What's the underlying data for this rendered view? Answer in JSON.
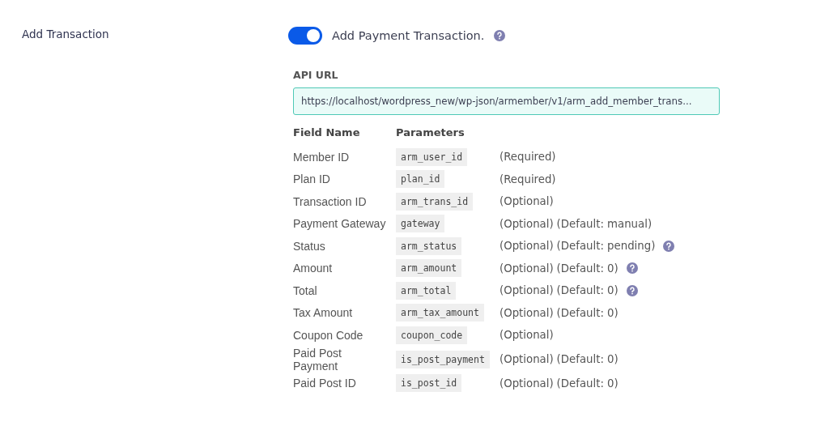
{
  "section_label": "Add Transaction",
  "toggle": {
    "on": true,
    "label": "Add Payment Transaction.",
    "help": true
  },
  "api_url": {
    "label": "API URL",
    "value": "https://localhost/wordpress_new/wp-json/armember/v1/arm_add_member_trans..."
  },
  "table": {
    "columns": [
      "Field Name",
      "Parameters"
    ],
    "rows": [
      {
        "field": "Member ID",
        "param": "arm_user_id",
        "notes": [
          "(Required)"
        ],
        "help": false
      },
      {
        "field": "Plan ID",
        "param": "plan_id",
        "notes": [
          "(Required)"
        ],
        "help": false
      },
      {
        "field": "Transaction ID",
        "param": "arm_trans_id",
        "notes": [
          "(Optional)"
        ],
        "help": false
      },
      {
        "field": "Payment Gateway",
        "param": "gateway",
        "notes": [
          "(Optional)",
          "(Default: manual)"
        ],
        "help": false
      },
      {
        "field": "Status",
        "param": "arm_status",
        "notes": [
          "(Optional)",
          "(Default: pending)"
        ],
        "help": true
      },
      {
        "field": "Amount",
        "param": "arm_amount",
        "notes": [
          "(Optional)",
          "(Default: 0)"
        ],
        "help": true
      },
      {
        "field": "Total",
        "param": "arm_total",
        "notes": [
          "(Optional)",
          "(Default: 0)"
        ],
        "help": true
      },
      {
        "field": "Tax Amount",
        "param": "arm_tax_amount",
        "notes": [
          "(Optional)",
          "(Default: 0)"
        ],
        "help": false
      },
      {
        "field": "Coupon Code",
        "param": "coupon_code",
        "notes": [
          "(Optional)"
        ],
        "help": false
      },
      {
        "field": "Paid Post Payment",
        "param": "is_post_payment",
        "notes": [
          "(Optional)",
          "(Default: 0)"
        ],
        "help": false
      },
      {
        "field": "Paid Post ID",
        "param": "is_post_id",
        "notes": [
          "(Optional)",
          "(Default: 0)"
        ],
        "help": false
      }
    ]
  }
}
